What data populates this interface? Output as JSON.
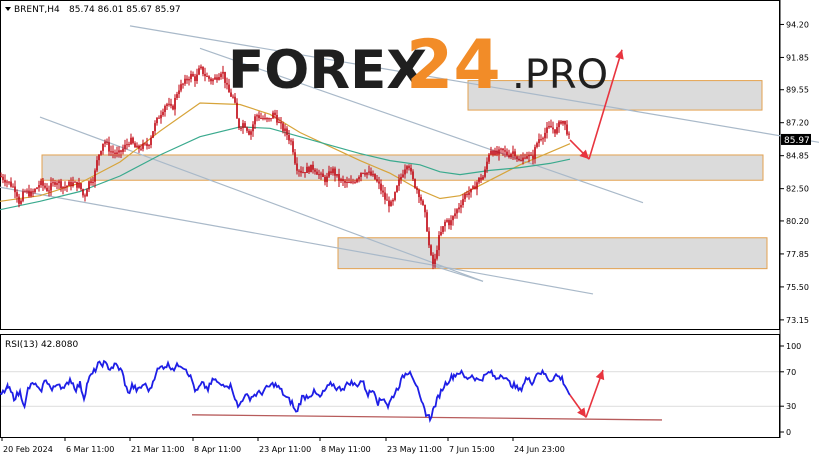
{
  "header": {
    "symbol_caption": "BRENT,H4",
    "ohlc_caption": "85.74 86.01 85.67 85.97"
  },
  "watermark": {
    "brand_main": "FOREX",
    "brand_num": "24",
    "brand_suffix": ".PRO"
  },
  "colors": {
    "candles": "#c0000c",
    "ma_fast": "#d7a43a",
    "ma_slow": "#3aaa8e",
    "trend_lines": "#a9b9c9",
    "zone_fill": "#d5d5d5",
    "zone_border": "#e3a14f",
    "arrows": "#e8343f",
    "rsi_line": "#1e1ee6",
    "rsi_support": "#b75b5b",
    "price_tag_bg": "#000000",
    "watermark": "#1f1f1f",
    "watermark_accent": "#f28c28"
  },
  "chart_data": [
    {
      "type": "candlestick",
      "title": "BRENT,H4",
      "ylim": [
        72.5,
        95.8
      ],
      "y_ticks": [
        "94.20",
        "91.85",
        "89.55",
        "87.20",
        "84.85",
        "82.50",
        "80.20",
        "77.85",
        "75.50",
        "73.15"
      ],
      "y_tick_values": [
        94.2,
        91.85,
        89.55,
        87.2,
        84.85,
        82.5,
        80.2,
        77.85,
        75.5,
        73.15
      ],
      "current_price_label": "85.97",
      "current_price": 85.97,
      "grid": false,
      "x_tick_labels": [
        "20 Feb 2024",
        "6 Mar 11:00",
        "21 Mar 11:00",
        "8 Apr 11:00",
        "23 Apr 11:00",
        "8 May 11:00",
        "23 May 11:00",
        "7 Jun 15:00",
        "24 Jun 23:00"
      ],
      "close_path": [
        [
          0,
          83.4
        ],
        [
          8,
          83.0
        ],
        [
          16,
          82.4
        ],
        [
          20,
          81.3
        ],
        [
          24,
          82.3
        ],
        [
          32,
          82.1
        ],
        [
          40,
          82.9
        ],
        [
          48,
          82.4
        ],
        [
          56,
          83.1
        ],
        [
          64,
          82.6
        ],
        [
          72,
          82.9
        ],
        [
          80,
          82.7
        ],
        [
          84,
          81.8
        ],
        [
          88,
          82.9
        ],
        [
          94,
          83.3
        ],
        [
          98,
          84.8
        ],
        [
          104,
          86.0
        ],
        [
          110,
          85.2
        ],
        [
          118,
          84.9
        ],
        [
          124,
          85.4
        ],
        [
          130,
          86.0
        ],
        [
          136,
          85.3
        ],
        [
          142,
          85.5
        ],
        [
          148,
          85.6
        ],
        [
          154,
          86.9
        ],
        [
          160,
          87.8
        ],
        [
          166,
          88.6
        ],
        [
          172,
          88.1
        ],
        [
          178,
          89.6
        ],
        [
          184,
          90.0
        ],
        [
          190,
          90.6
        ],
        [
          196,
          90.3
        ],
        [
          200,
          91.1
        ],
        [
          206,
          90.5
        ],
        [
          212,
          90.2
        ],
        [
          216,
          90.4
        ],
        [
          222,
          91.0
        ],
        [
          228,
          89.4
        ],
        [
          234,
          88.9
        ],
        [
          238,
          86.9
        ],
        [
          244,
          87.2
        ],
        [
          250,
          86.4
        ],
        [
          256,
          87.8
        ],
        [
          262,
          87.5
        ],
        [
          268,
          87.3
        ],
        [
          274,
          87.9
        ],
        [
          280,
          87.0
        ],
        [
          286,
          86.5
        ],
        [
          292,
          85.7
        ],
        [
          296,
          84.1
        ],
        [
          302,
          83.7
        ],
        [
          308,
          83.9
        ],
        [
          314,
          84.0
        ],
        [
          320,
          83.4
        ],
        [
          326,
          83.1
        ],
        [
          332,
          83.9
        ],
        [
          338,
          83.2
        ],
        [
          344,
          82.9
        ],
        [
          350,
          82.8
        ],
        [
          356,
          83.2
        ],
        [
          362,
          83.8
        ],
        [
          368,
          83.6
        ],
        [
          374,
          83.3
        ],
        [
          380,
          82.6
        ],
        [
          386,
          81.6
        ],
        [
          392,
          81.3
        ],
        [
          398,
          82.8
        ],
        [
          404,
          83.9
        ],
        [
          408,
          84.5
        ],
        [
          412,
          83.2
        ],
        [
          416,
          82.6
        ],
        [
          420,
          82.0
        ],
        [
          426,
          80.3
        ],
        [
          430,
          77.8
        ],
        [
          434,
          76.9
        ],
        [
          438,
          78.8
        ],
        [
          442,
          79.5
        ],
        [
          446,
          80.3
        ],
        [
          450,
          80.0
        ],
        [
          454,
          80.6
        ],
        [
          460,
          81.4
        ],
        [
          466,
          82.2
        ],
        [
          472,
          82.3
        ],
        [
          478,
          83.1
        ],
        [
          484,
          83.4
        ],
        [
          490,
          85.4
        ],
        [
          496,
          84.9
        ],
        [
          502,
          85.2
        ],
        [
          508,
          84.9
        ],
        [
          514,
          85.2
        ],
        [
          520,
          84.3
        ],
        [
          526,
          85.0
        ],
        [
          532,
          84.6
        ],
        [
          538,
          86.0
        ],
        [
          544,
          86.4
        ],
        [
          550,
          86.9
        ],
        [
          556,
          86.6
        ],
        [
          562,
          87.5
        ],
        [
          566,
          86.8
        ],
        [
          570,
          85.97
        ]
      ],
      "series": [
        {
          "name": "",
          "type": "line",
          "points": [
            [
              0,
              81.6
            ],
            [
              40,
              82.0
            ],
            [
              80,
              82.9
            ],
            [
              120,
              84.4
            ],
            [
              160,
              86.6
            ],
            [
              200,
              88.6
            ],
            [
              240,
              88.5
            ],
            [
              270,
              87.8
            ],
            [
              300,
              86.5
            ],
            [
              330,
              85.5
            ],
            [
              360,
              84.5
            ],
            [
              390,
              83.6
            ],
            [
              420,
              82.4
            ],
            [
              440,
              81.8
            ],
            [
              460,
              82.0
            ],
            [
              490,
              83.1
            ],
            [
              520,
              84.2
            ],
            [
              550,
              85.1
            ],
            [
              570,
              85.7
            ]
          ]
        },
        {
          "name": "",
          "type": "line",
          "points": [
            [
              0,
              81.0
            ],
            [
              40,
              81.6
            ],
            [
              80,
              82.3
            ],
            [
              120,
              83.4
            ],
            [
              160,
              84.9
            ],
            [
              200,
              86.2
            ],
            [
              240,
              86.9
            ],
            [
              270,
              86.8
            ],
            [
              300,
              86.2
            ],
            [
              330,
              85.6
            ],
            [
              360,
              85.0
            ],
            [
              390,
              84.5
            ],
            [
              420,
              84.2
            ],
            [
              440,
              83.7
            ],
            [
              460,
              83.5
            ],
            [
              490,
              83.8
            ],
            [
              520,
              84.0
            ],
            [
              550,
              84.3
            ],
            [
              570,
              84.6
            ]
          ]
        }
      ],
      "trend_lines": [
        {
          "from": [
            130,
            94.1
          ],
          "to": [
            819,
            85.8
          ]
        },
        {
          "from": [
            200,
            92.5
          ],
          "to": [
            643,
            81.5
          ]
        },
        {
          "from": [
            40,
            87.6
          ],
          "to": [
            483,
            75.9
          ]
        },
        {
          "from": [
            0,
            82.6
          ],
          "to": [
            593,
            75.0
          ]
        },
        {
          "from": [
            433,
            77.0
          ],
          "to": [
            483,
            75.9
          ]
        }
      ],
      "zones": [
        {
          "x": [
            468,
            762
          ],
          "y": [
            88.1,
            90.2
          ]
        },
        {
          "x": [
            42,
            763
          ],
          "y": [
            83.1,
            84.9
          ]
        },
        {
          "x": [
            338,
            767
          ],
          "y": [
            76.8,
            79.0
          ]
        }
      ],
      "arrows": [
        {
          "from": [
            570,
            85.97
          ],
          "to": [
            589,
            84.6
          ]
        },
        {
          "from": [
            589,
            84.6
          ],
          "to": [
            622,
            92.4
          ]
        }
      ]
    },
    {
      "type": "line",
      "title": "RSI(13) 42.8080",
      "ylim": [
        0,
        100
      ],
      "y_ticks": [
        "100",
        "70",
        "30",
        "0"
      ],
      "y_tick_values": [
        100,
        70,
        30,
        0
      ],
      "grid": false,
      "series": [
        {
          "name": "",
          "points": [
            [
              0,
              42
            ],
            [
              8,
              52
            ],
            [
              14,
              40
            ],
            [
              20,
              46
            ],
            [
              25,
              30
            ],
            [
              28,
              50
            ],
            [
              34,
              57
            ],
            [
              40,
              46
            ],
            [
              46,
              62
            ],
            [
              52,
              48
            ],
            [
              58,
              58
            ],
            [
              64,
              49
            ],
            [
              70,
              62
            ],
            [
              76,
              50
            ],
            [
              80,
              56
            ],
            [
              84,
              40
            ],
            [
              88,
              60
            ],
            [
              94,
              70
            ],
            [
              98,
              78
            ],
            [
              104,
              80
            ],
            [
              110,
              74
            ],
            [
              116,
              78
            ],
            [
              122,
              70
            ],
            [
              128,
              44
            ],
            [
              132,
              54
            ],
            [
              138,
              48
            ],
            [
              144,
              56
            ],
            [
              150,
              48
            ],
            [
              156,
              70
            ],
            [
              162,
              76
            ],
            [
              168,
              78
            ],
            [
              174,
              74
            ],
            [
              180,
              79
            ],
            [
              186,
              74
            ],
            [
              192,
              60
            ],
            [
              196,
              46
            ],
            [
              202,
              56
            ],
            [
              208,
              50
            ],
            [
              214,
              62
            ],
            [
              220,
              54
            ],
            [
              226,
              56
            ],
            [
              232,
              52
            ],
            [
              238,
              28
            ],
            [
              244,
              42
            ],
            [
              250,
              40
            ],
            [
              256,
              44
            ],
            [
              262,
              46
            ],
            [
              268,
              52
            ],
            [
              274,
              56
            ],
            [
              280,
              50
            ],
            [
              286,
              40
            ],
            [
              292,
              34
            ],
            [
              296,
              22
            ],
            [
              302,
              40
            ],
            [
              308,
              42
            ],
            [
              314,
              46
            ],
            [
              320,
              40
            ],
            [
              326,
              50
            ],
            [
              332,
              56
            ],
            [
              338,
              50
            ],
            [
              344,
              52
            ],
            [
              350,
              58
            ],
            [
              356,
              54
            ],
            [
              362,
              60
            ],
            [
              368,
              44
            ],
            [
              374,
              50
            ],
            [
              378,
              34
            ],
            [
              384,
              40
            ],
            [
              388,
              30
            ],
            [
              392,
              40
            ],
            [
              398,
              52
            ],
            [
              404,
              66
            ],
            [
              410,
              72
            ],
            [
              416,
              56
            ],
            [
              420,
              38
            ],
            [
              426,
              22
            ],
            [
              430,
              16
            ],
            [
              434,
              28
            ],
            [
              438,
              40
            ],
            [
              444,
              54
            ],
            [
              450,
              62
            ],
            [
              454,
              66
            ],
            [
              460,
              70
            ],
            [
              466,
              62
            ],
            [
              472,
              66
            ],
            [
              478,
              60
            ],
            [
              484,
              64
            ],
            [
              490,
              70
            ],
            [
              496,
              62
            ],
            [
              502,
              68
            ],
            [
              508,
              58
            ],
            [
              514,
              54
            ],
            [
              520,
              48
            ],
            [
              526,
              62
            ],
            [
              532,
              58
            ],
            [
              538,
              70
            ],
            [
              544,
              68
            ],
            [
              550,
              60
            ],
            [
              556,
              66
            ],
            [
              562,
              62
            ],
            [
              566,
              52
            ],
            [
              570,
              43
            ]
          ]
        }
      ],
      "support_line": {
        "from": [
          192,
          20
        ],
        "to": [
          662,
          14
        ]
      },
      "arrows": [
        {
          "from": [
            570,
            43
          ],
          "to": [
            586,
            17
          ]
        },
        {
          "from": [
            586,
            17
          ],
          "to": [
            603,
            72
          ]
        }
      ]
    }
  ]
}
